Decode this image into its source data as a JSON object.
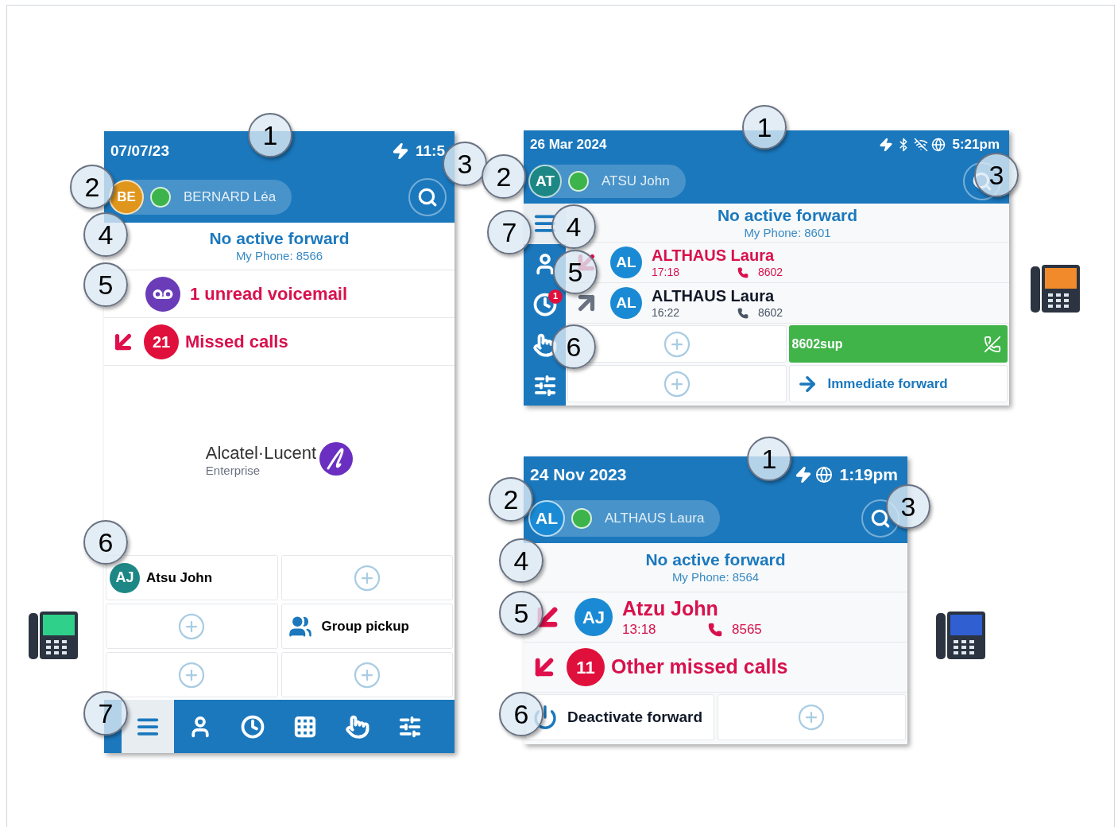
{
  "screens": [
    {
      "kind": "portrait",
      "date": "07/07/23",
      "time": "11:5",
      "user": {
        "initials": "BE",
        "color": "#e0961c",
        "available": true,
        "name": "BERNARD Léa"
      },
      "forward": {
        "title": "No active forward",
        "subtitle": "My Phone: 8566"
      },
      "events": [
        {
          "kind": "voicemail",
          "text": "1 unread voicemail"
        },
        {
          "kind": "missed_summary",
          "count": "21",
          "text": "Missed calls"
        }
      ],
      "logo": {
        "name": "Alcatel·Lucent",
        "tagline": "Enterprise"
      },
      "keys": [
        {
          "kind": "contact",
          "initials": "AJ",
          "color": "#1d8785",
          "label": "Atsu John"
        },
        {
          "kind": "add"
        },
        {
          "kind": "add"
        },
        {
          "kind": "pickup",
          "label": "Group pickup"
        },
        {
          "kind": "add"
        },
        {
          "kind": "add"
        }
      ],
      "nav": [
        {
          "kind": "home",
          "selected": true
        },
        {
          "kind": "contacts",
          "selected": false
        },
        {
          "kind": "history",
          "selected": false
        },
        {
          "kind": "dialer",
          "selected": false
        },
        {
          "kind": "programming",
          "selected": false
        },
        {
          "kind": "settings",
          "selected": false
        }
      ],
      "callouts": [
        "1",
        "2",
        "3",
        "4",
        "5",
        "6",
        "7"
      ]
    },
    {
      "kind": "sidebar",
      "date": "26 Mar 2024",
      "time": "5:21pm",
      "user": {
        "initials": "AT",
        "color": "#1d8785",
        "available": true,
        "name": "ATSU John"
      },
      "forward": {
        "title": "No active forward",
        "subtitle": "My Phone: 8601"
      },
      "events": [
        {
          "kind": "call",
          "missed": true,
          "initials": "AL",
          "color": "#1a8ad4",
          "name": "ALTHAUS Laura",
          "time": "17:18",
          "number": "8602"
        },
        {
          "kind": "call",
          "missed": false,
          "initials": "AL",
          "color": "#1a8ad4",
          "name": "ALTHAUS Laura",
          "time": "16:22",
          "number": "8602"
        }
      ],
      "keys": [
        {
          "kind": "add"
        },
        {
          "kind": "call_active",
          "label": "8602sup"
        },
        {
          "kind": "add"
        },
        {
          "kind": "forward",
          "label": "Immediate forward"
        }
      ],
      "nav": [
        {
          "kind": "home",
          "selected": true
        },
        {
          "kind": "contacts",
          "selected": false
        },
        {
          "kind": "history",
          "selected": false,
          "badge": "1"
        },
        {
          "kind": "programming",
          "selected": false
        },
        {
          "kind": "settings",
          "selected": false
        }
      ],
      "callouts": [
        "1",
        "2",
        "3",
        "4",
        "5",
        "6",
        "7"
      ]
    },
    {
      "kind": "landscape",
      "date": "24 Nov 2023",
      "time": "1:19pm",
      "user": {
        "initials": "AL",
        "color": "#1a8ad4",
        "available": true,
        "name": "ALTHAUS Laura"
      },
      "forward": {
        "title": "No active forward",
        "subtitle": "My Phone: 8564"
      },
      "events": [
        {
          "kind": "call",
          "missed": true,
          "initials": "AJ",
          "color": "#1a8ad4",
          "name": "Atzu John",
          "time": "13:18",
          "number": "8565"
        },
        {
          "kind": "missed_summary",
          "count": "11",
          "text": "Other missed calls"
        }
      ],
      "keys": [
        {
          "kind": "deactivate",
          "label": "Deactivate forward"
        },
        {
          "kind": "add"
        }
      ],
      "callouts": [
        "1",
        "2",
        "3",
        "4",
        "5",
        "6"
      ]
    }
  ]
}
